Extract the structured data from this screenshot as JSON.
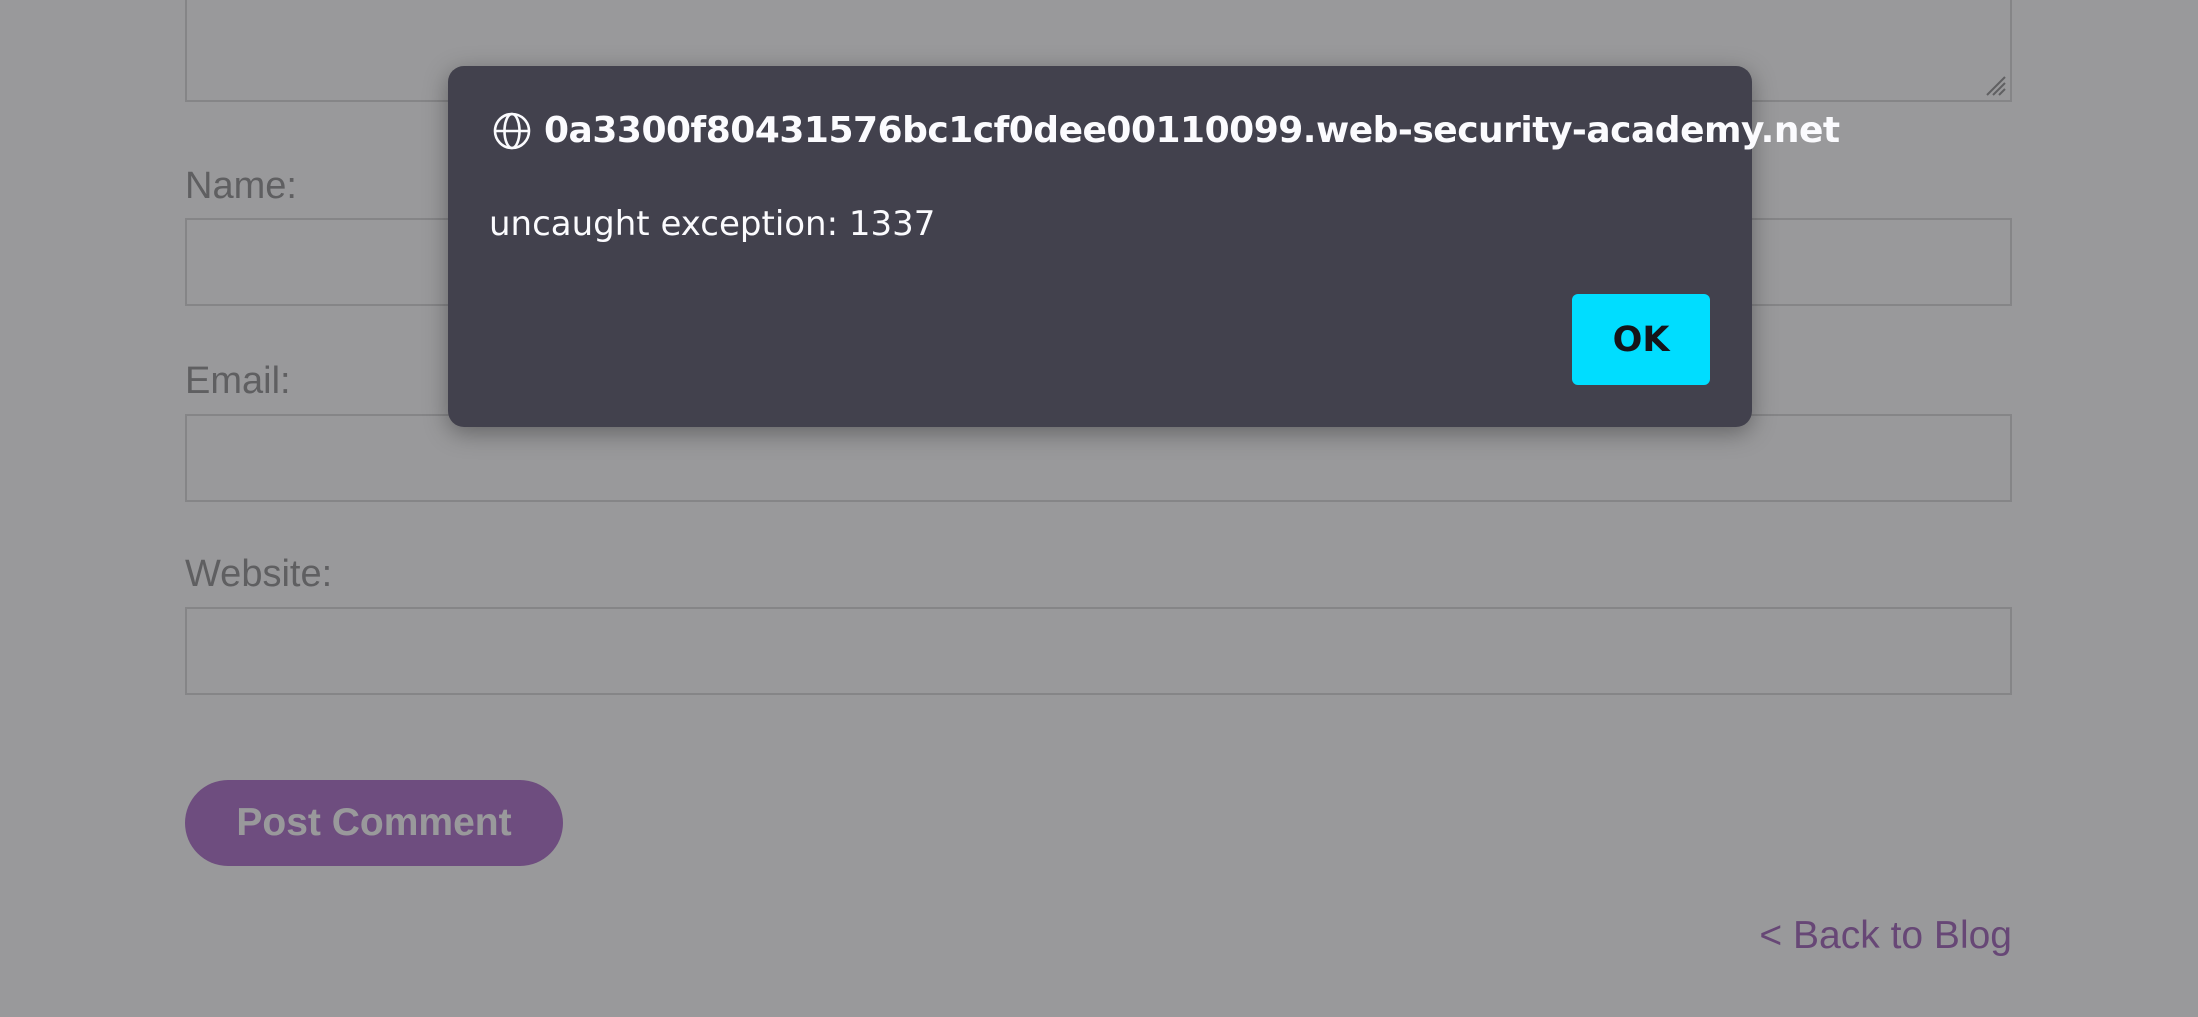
{
  "form": {
    "name_label": "Name:",
    "email_label": "Email:",
    "website_label": "Website:",
    "name_value": "",
    "email_value": "",
    "website_value": "",
    "submit_label": "Post Comment",
    "back_link": "< Back to Blog"
  },
  "dialog": {
    "origin": "0a3300f80431576bc1cf0dee00110099.web-security-academy.net",
    "message": "uncaught exception: 1337",
    "ok_label": "OK",
    "origin_icon": "globe-icon"
  },
  "colors": {
    "brand_purple": "#a967c6",
    "dialog_background": "#42414d",
    "ok_button": "#00ddff",
    "overlay": "rgba(52,52,56,0.5)"
  }
}
